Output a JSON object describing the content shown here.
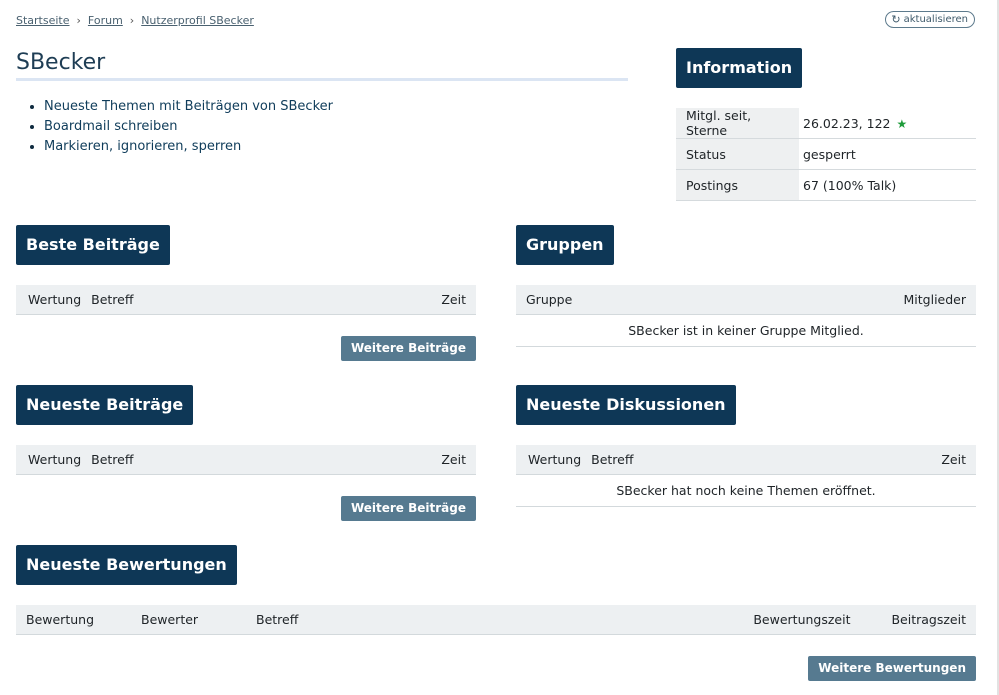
{
  "breadcrumb": {
    "items": [
      "Startseite",
      "Forum",
      "Nutzerprofil SBecker"
    ]
  },
  "refresh_label": "aktualisieren",
  "user": {
    "name": "SBecker",
    "links": [
      "Neueste Themen mit Beiträgen von SBecker",
      "Boardmail schreiben",
      "Markieren, ignorieren, sperren"
    ]
  },
  "information": {
    "title": "Information",
    "rows": [
      {
        "label": "Mitgl. seit, Sterne",
        "value": "26.02.23, 122"
      },
      {
        "label": "Status",
        "value": "gesperrt"
      },
      {
        "label": "Postings",
        "value": "67 (100% Talk)"
      }
    ]
  },
  "beste_beitraege": {
    "title": "Beste Beiträge",
    "columns": [
      "Wertung",
      "Betreff",
      "Zeit"
    ],
    "button": "Weitere Beiträge"
  },
  "gruppen": {
    "title": "Gruppen",
    "columns": [
      "Gruppe",
      "Mitglieder"
    ],
    "empty": "SBecker ist in keiner Gruppe Mitglied."
  },
  "neueste_beitraege": {
    "title": "Neueste Beiträge",
    "columns": [
      "Wertung",
      "Betreff",
      "Zeit"
    ],
    "button": "Weitere Beiträge"
  },
  "neueste_diskussionen": {
    "title": "Neueste Diskussionen",
    "columns": [
      "Wertung",
      "Betreff",
      "Zeit"
    ],
    "empty": "SBecker hat noch keine Themen eröffnet."
  },
  "neueste_bewertungen": {
    "title": "Neueste Bewertungen",
    "columns": [
      "Bewertung",
      "Bewerter",
      "Betreff",
      "Bewertungszeit",
      "Beitragszeit"
    ],
    "button": "Weitere Bewertungen"
  },
  "colors": {
    "heading_bg": "#0e3756",
    "button_bg": "#567a90",
    "table_header_bg": "#edf0f2",
    "star": "#1e9b3a"
  },
  "icons": {
    "star": "star-icon",
    "refresh": "refresh-icon",
    "breadcrumb_separator": "chevron-right-icon"
  }
}
